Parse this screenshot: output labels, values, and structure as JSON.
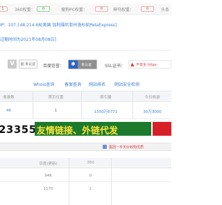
{
  "top": {
    "first_value": "1",
    "rank360": {
      "label": "360权重：",
      "value": "0"
    },
    "pc": {
      "label": "搜狗PC权重：",
      "value": "0"
    },
    "shenma": {
      "label": "神马权重：",
      "value": "0"
    },
    "toutiao": {
      "label": "头条"
    }
  },
  "ip": "IP：107.148.214.68[美国 加利福尼亚州洛杉矶PetaExpress]",
  "expiry": "过期时间为2021年08月08日]",
  "trust": {
    "unverified1": "未认证",
    "baidu_label": "百度信誉：",
    "unverified2": "未认证",
    "ssl_label": "SSL证书：",
    "ssl_status": "不安全 https:"
  },
  "links": [
    "Whois查询",
    "备案查询",
    "网站排名",
    "网站安全检测"
  ],
  "stats": {
    "headers": [
      "收录数",
      "首页位置",
      "索引量",
      "今日收录"
    ],
    "values": [
      "46",
      "1",
      "1550万6771",
      "30万3000"
    ]
  },
  "banner": {
    "number": "23355",
    "slogan": "友情链接、外链代发"
  },
  "notice": "集团一手天价收购优质",
  "table2": {
    "headers": [
      "百度(更新)",
      "360"
    ],
    "rows": [
      [
        "946",
        "0"
      ],
      [
        "1170",
        "1"
      ]
    ]
  },
  "colors": {
    "blue": "#3b7ed6",
    "red": "#e03c3c",
    "green_banner": "#1c7a2c",
    "slogan_yellow": "#ffe43a",
    "header_bg": "#f3f5f8"
  }
}
